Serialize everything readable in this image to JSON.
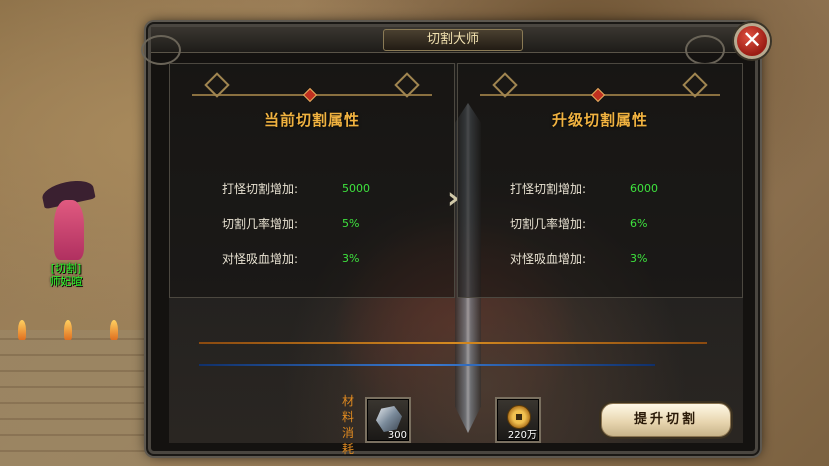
{
  "world": {
    "npc_name_line1": "[切割]",
    "npc_name_line2": "师妃暄"
  },
  "dialog": {
    "title": "切割大师",
    "close_symbol": "✕"
  },
  "current": {
    "title": "当前切割属性",
    "stats": [
      {
        "label": "打怪切割增加:",
        "value": "5000"
      },
      {
        "label": "切割几率增加:",
        "value": "5%"
      },
      {
        "label": "对怪吸血增加:",
        "value": "3%"
      }
    ]
  },
  "upgrade": {
    "title": "升级切割属性",
    "stats": [
      {
        "label": "打怪切割增加:",
        "value": "6000"
      },
      {
        "label": "切割几率增加:",
        "value": "6%"
      },
      {
        "label": "对怪吸血增加:",
        "value": "3%"
      }
    ]
  },
  "materials": {
    "label": "材料消耗",
    "items": [
      {
        "icon": "ore-icon",
        "count": "300"
      },
      {
        "icon": "coin-icon",
        "count": "220万"
      }
    ]
  },
  "actions": {
    "upgrade_label": "提升切割"
  },
  "colors": {
    "title_gold": "#f0b240",
    "value_green": "#3ee23e",
    "material_orange": "#e08a20"
  }
}
